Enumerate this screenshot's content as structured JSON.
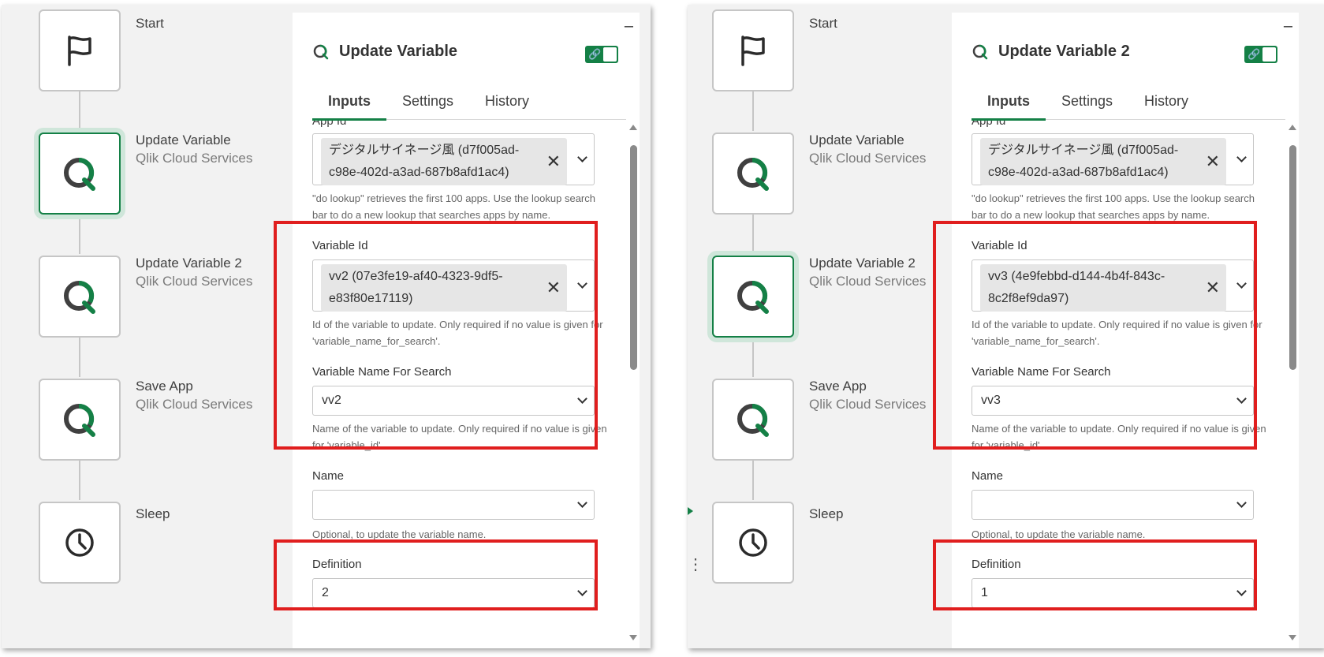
{
  "screens": [
    {
      "flow": {
        "nodes": [
          {
            "title": "Start",
            "sub": "",
            "icon": "flag-icon"
          },
          {
            "title": "Update Variable",
            "sub": "Qlik Cloud Services",
            "icon": "qlik-icon"
          },
          {
            "title": "Update Variable 2",
            "sub": "Qlik Cloud Services",
            "icon": "qlik-icon"
          },
          {
            "title": "Save App",
            "sub": "Qlik Cloud Services",
            "icon": "qlik-icon"
          },
          {
            "title": "Sleep",
            "sub": "",
            "icon": "clock-icon"
          }
        ],
        "selected_index": 1
      },
      "panel": {
        "minimize": "–",
        "title": "Update Variable",
        "toggle_icon": "🔗",
        "tabs": [
          "Inputs",
          "Settings",
          "History"
        ],
        "active_tab": "Inputs",
        "app_id_label": "App Id",
        "app_id_value": "デジタルサイネージ風 (d7f005ad-c98e-402d-a3ad-687b8afd1ac4)",
        "app_id_help": "\"do lookup\" retrieves the first 100 apps. Use the lookup search bar to do a new lookup that searches apps by name.",
        "variable_id_label": "Variable Id",
        "variable_id_value": "vv2 (07e3fe19-af40-4323-9df5-e83f80e17119)",
        "variable_id_help": "Id of the variable to update. Only required if no value is given for 'variable_name_for_search'.",
        "var_name_label": "Variable Name For Search",
        "var_name_value": "vv2",
        "var_name_help": "Name of the variable to update. Only required if no value is given for 'variable_id'.",
        "name_label": "Name",
        "name_value": "",
        "name_help": "Optional, to update the variable name.",
        "definition_label": "Definition",
        "definition_value": "2"
      }
    },
    {
      "flow": {
        "nodes": [
          {
            "title": "Start",
            "sub": "",
            "icon": "flag-icon"
          },
          {
            "title": "Update Variable",
            "sub": "Qlik Cloud Services",
            "icon": "qlik-icon"
          },
          {
            "title": "Update Variable 2",
            "sub": "Qlik Cloud Services",
            "icon": "qlik-icon"
          },
          {
            "title": "Save App",
            "sub": "Qlik Cloud Services",
            "icon": "qlik-icon"
          },
          {
            "title": "Sleep",
            "sub": "",
            "icon": "clock-icon"
          }
        ],
        "selected_index": 2,
        "dots": "⋮"
      },
      "panel": {
        "minimize": "–",
        "title": "Update Variable 2",
        "toggle_icon": "🔗",
        "tabs": [
          "Inputs",
          "Settings",
          "History"
        ],
        "active_tab": "Inputs",
        "app_id_label": "App Id",
        "app_id_value": "デジタルサイネージ風 (d7f005ad-c98e-402d-a3ad-687b8afd1ac4)",
        "app_id_help": "\"do lookup\" retrieves the first 100 apps. Use the lookup search bar to do a new lookup that searches apps by name.",
        "variable_id_label": "Variable Id",
        "variable_id_value": "vv3 (4e9febbd-d144-4b4f-843c-8c2f8ef9da97)",
        "variable_id_help": "Id of the variable to update. Only required if no value is given for 'variable_name_for_search'.",
        "var_name_label": "Variable Name For Search",
        "var_name_value": "vv3",
        "var_name_help": "Name of the variable to update. Only required if no value is given for 'variable_id'.",
        "name_label": "Name",
        "name_value": "",
        "name_help": "Optional, to update the variable name.",
        "definition_label": "Definition",
        "definition_value": "1"
      }
    }
  ],
  "colors": {
    "accent": "#148046",
    "highlight": "#e01e1e"
  }
}
